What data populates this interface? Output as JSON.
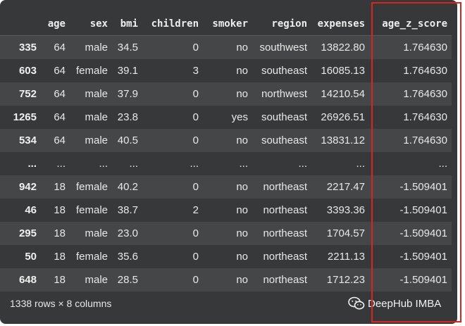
{
  "table": {
    "columns": [
      "",
      "age",
      "sex",
      "bmi",
      "children",
      "smoker",
      "region",
      "expenses",
      "age_z_score"
    ],
    "rows": [
      [
        "335",
        "64",
        "male",
        "34.5",
        "0",
        "no",
        "southwest",
        "13822.80",
        "1.764630"
      ],
      [
        "603",
        "64",
        "female",
        "39.1",
        "3",
        "no",
        "southeast",
        "16085.13",
        "1.764630"
      ],
      [
        "752",
        "64",
        "male",
        "37.9",
        "0",
        "no",
        "northwest",
        "14210.54",
        "1.764630"
      ],
      [
        "1265",
        "64",
        "male",
        "23.8",
        "0",
        "yes",
        "southeast",
        "26926.51",
        "1.764630"
      ],
      [
        "534",
        "64",
        "male",
        "40.5",
        "0",
        "no",
        "southeast",
        "13831.12",
        "1.764630"
      ],
      [
        "...",
        "...",
        "...",
        "...",
        "...",
        "...",
        "...",
        "...",
        "..."
      ],
      [
        "942",
        "18",
        "female",
        "40.2",
        "0",
        "no",
        "northeast",
        "2217.47",
        "-1.509401"
      ],
      [
        "46",
        "18",
        "female",
        "38.7",
        "2",
        "no",
        "northeast",
        "3393.36",
        "-1.509401"
      ],
      [
        "295",
        "18",
        "male",
        "23.0",
        "0",
        "no",
        "northeast",
        "1704.57",
        "-1.509401"
      ],
      [
        "50",
        "18",
        "female",
        "35.6",
        "0",
        "no",
        "northeast",
        "2211.13",
        "-1.509401"
      ],
      [
        "648",
        "18",
        "male",
        "28.5",
        "0",
        "no",
        "northeast",
        "1712.23",
        "-1.509401"
      ]
    ],
    "footer": "1338 rows × 8 columns"
  },
  "watermark": {
    "text": "DeepHub IMBA",
    "logo_icon": "wechat-icon"
  },
  "highlight": {
    "color": "#d9251c",
    "column": "age_z_score"
  }
}
